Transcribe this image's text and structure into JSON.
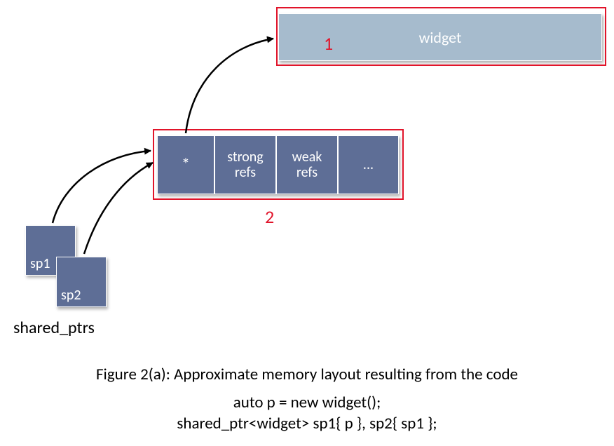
{
  "widget": {
    "label": "widget"
  },
  "control_block": {
    "ptr": "*",
    "strong": "strong\nrefs",
    "weak": "weak\nrefs",
    "more": "..."
  },
  "pointers": {
    "sp1": "sp1",
    "sp2": "sp2",
    "group_label": "shared_ptrs"
  },
  "annotations": {
    "n1": "1",
    "n2": "2"
  },
  "caption": {
    "title": "Figure 2(a): Approximate memory layout resulting from the code",
    "code1": "auto p = new widget();",
    "code2": "shared_ptr<widget> sp1{ p }, sp2{ sp1 };"
  }
}
